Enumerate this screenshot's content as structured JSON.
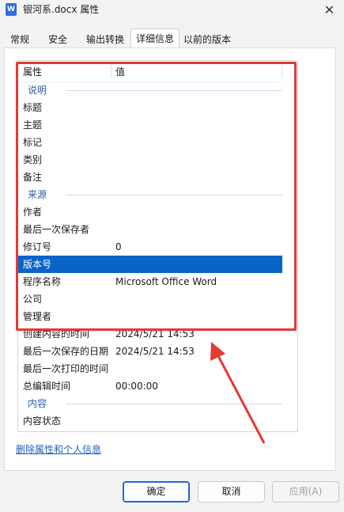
{
  "window": {
    "app_icon": "W",
    "title": "银河系.docx 属性",
    "close_symbol": "✕"
  },
  "tabs": [
    {
      "label": "常规"
    },
    {
      "label": "安全"
    },
    {
      "label": "输出转换"
    },
    {
      "label": "详细信息",
      "active": true
    },
    {
      "label": "以前的版本"
    }
  ],
  "table": {
    "header": {
      "property": "属性",
      "value": "值"
    },
    "rows": [
      {
        "type": "group",
        "name": "说明"
      },
      {
        "type": "item",
        "name": "标题",
        "value": ""
      },
      {
        "type": "item",
        "name": "主题",
        "value": ""
      },
      {
        "type": "item",
        "name": "标记",
        "value": ""
      },
      {
        "type": "item",
        "name": "类别",
        "value": ""
      },
      {
        "type": "item",
        "name": "备注",
        "value": ""
      },
      {
        "type": "group",
        "name": "来源"
      },
      {
        "type": "item",
        "name": "作者",
        "value": ""
      },
      {
        "type": "item",
        "name": "最后一次保存者",
        "value": ""
      },
      {
        "type": "item",
        "name": "修订号",
        "value": "0"
      },
      {
        "type": "item",
        "name": "版本号",
        "value": "",
        "selected": true
      },
      {
        "type": "item",
        "name": "程序名称",
        "value": "Microsoft Office Word"
      },
      {
        "type": "item",
        "name": "公司",
        "value": ""
      },
      {
        "type": "item",
        "name": "管理者",
        "value": ""
      },
      {
        "type": "item",
        "name": "创建内容的时间",
        "value": "2024/5/21 14:53"
      },
      {
        "type": "item",
        "name": "最后一次保存的日期",
        "value": "2024/5/21 14:53"
      },
      {
        "type": "item",
        "name": "最后一次打印的时间",
        "value": ""
      },
      {
        "type": "item",
        "name": "总编辑时间",
        "value": "00:00:00"
      },
      {
        "type": "group",
        "name": "内容"
      },
      {
        "type": "item",
        "name": "内容状态",
        "value": ""
      }
    ]
  },
  "remove_link": "删除属性和个人信息",
  "buttons": {
    "ok": "确定",
    "cancel": "取消",
    "apply": "应用(A)"
  },
  "colors": {
    "selection": "#0a64c8",
    "annotation": "#e53935",
    "link": "#1f5fbf"
  }
}
